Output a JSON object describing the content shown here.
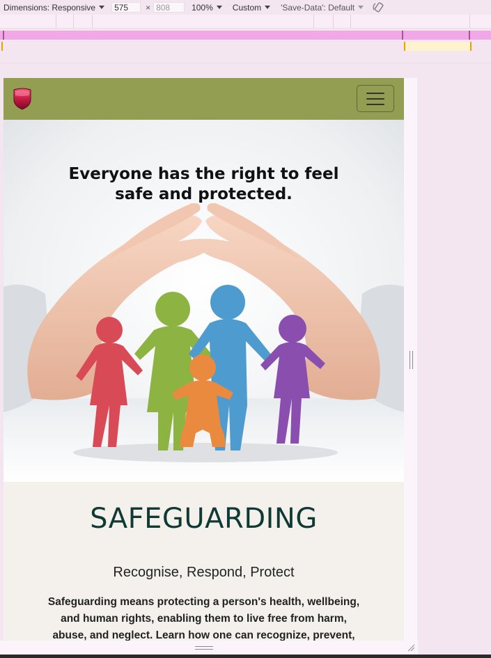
{
  "devtools": {
    "dimensions_label": "Dimensions: Responsive",
    "width_value": "575",
    "times": "×",
    "height_placeholder": "808",
    "zoom": "100%",
    "throttle": "Custom",
    "save_data": "'Save-Data': Default"
  },
  "navbar": {
    "background": "#949e52",
    "logo_icon": "shield-icon",
    "toggler_icon": "hamburger-icon"
  },
  "hero": {
    "headline_line1": "Everyone has the right to feel",
    "headline_line2": "safe and protected.",
    "image_icon": "hands-protecting-family-image"
  },
  "section": {
    "title": "SAFEGUARDING",
    "subtitle": "Recognise, Respond, Protect",
    "body": "Safeguarding means protecting a person's health, wellbeing, and human rights, enabling them to live free from harm, abuse, and neglect. Learn how one can recognize, prevent, and respond to"
  }
}
